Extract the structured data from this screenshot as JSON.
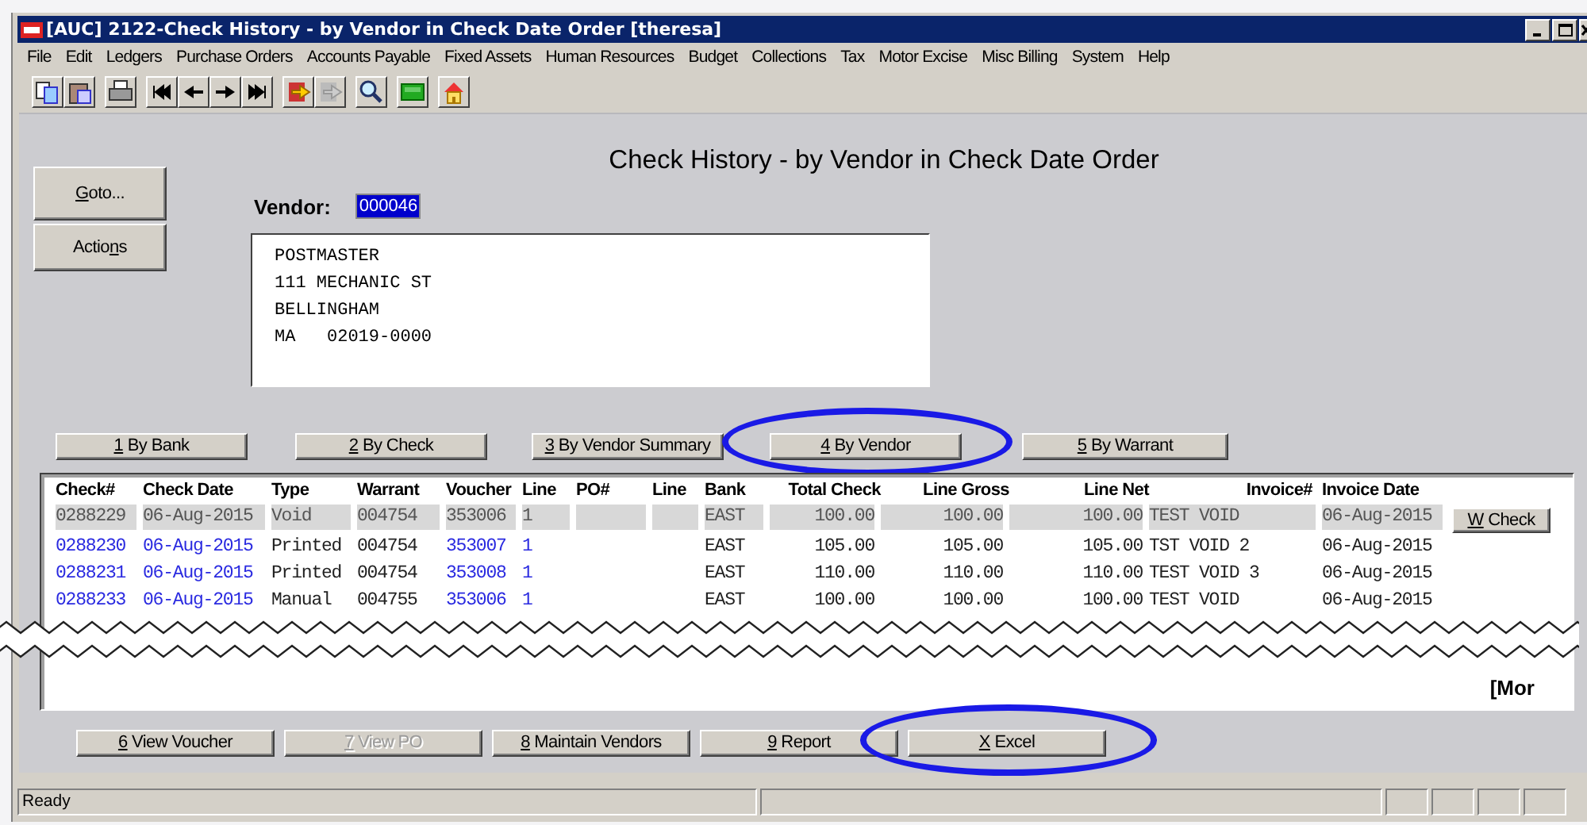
{
  "window": {
    "title": "[AUC] 2122-Check History - by Vendor in Check Date Order [theresa]"
  },
  "menu": [
    "File",
    "Edit",
    "Ledgers",
    "Purchase Orders",
    "Accounts Payable",
    "Fixed Assets",
    "Human Resources",
    "Budget",
    "Collections",
    "Tax",
    "Motor Excise",
    "Misc Billing",
    "System",
    "Help"
  ],
  "side_buttons": [
    {
      "label": "Goto..."
    },
    {
      "label": "Actions"
    }
  ],
  "heading": "Check History - by Vendor in Check Date Order",
  "vendor": {
    "label": "Vendor:",
    "value": "000046"
  },
  "address": [
    "POSTMASTER",
    "111 MECHANIC ST",
    "BELLINGHAM",
    "MA   02019-0000"
  ],
  "view_tabs": [
    {
      "label": "1 By Bank",
      "circled": false
    },
    {
      "label": "2 By Check",
      "circled": false
    },
    {
      "label": "3 By Vendor Summary",
      "circled": false
    },
    {
      "label": "4 By Vendor",
      "circled": true
    },
    {
      "label": "5 By Warrant",
      "circled": false
    }
  ],
  "table": {
    "columns": [
      {
        "label": "Check#",
        "kind": "link"
      },
      {
        "label": "Check Date",
        "kind": "link"
      },
      {
        "label": "Type",
        "kind": "text"
      },
      {
        "label": "Warrant",
        "kind": "text"
      },
      {
        "label": "Voucher",
        "kind": "link"
      },
      {
        "label": "Line",
        "kind": "link"
      },
      {
        "label": "PO#",
        "kind": "text"
      },
      {
        "label": "Line",
        "kind": "text"
      },
      {
        "label": "Bank",
        "kind": "text"
      },
      {
        "label": "Total Check",
        "kind": "text"
      },
      {
        "label": "Line Gross",
        "kind": "text"
      },
      {
        "label": "Line Net",
        "kind": "text"
      },
      {
        "label": "Invoice#",
        "kind": "text"
      },
      {
        "label": "Invoice Date",
        "kind": "text"
      }
    ],
    "rows": [
      {
        "selected": true,
        "cells": [
          "0288229",
          "06-Aug-2015",
          "Void",
          "004754",
          "353006",
          "1",
          "",
          "",
          "EAST",
          "100.00",
          "100.00",
          "100.00",
          "TEST VOID",
          "06-Aug-2015"
        ]
      },
      {
        "selected": false,
        "cells": [
          "0288230",
          "06-Aug-2015",
          "Printed",
          "004754",
          "353007",
          "1",
          "",
          "",
          "EAST",
          "105.00",
          "105.00",
          "105.00",
          "TST VOID 2",
          "06-Aug-2015"
        ]
      },
      {
        "selected": false,
        "cells": [
          "0288231",
          "06-Aug-2015",
          "Printed",
          "004754",
          "353008",
          "1",
          "",
          "",
          "EAST",
          "110.00",
          "110.00",
          "110.00",
          "TEST VOID 3",
          "06-Aug-2015"
        ]
      },
      {
        "selected": false,
        "cells": [
          "0288233",
          "06-Aug-2015",
          "Manual",
          "004755",
          "353006",
          "1",
          "",
          "",
          "EAST",
          "100.00",
          "100.00",
          "100.00",
          "TEST VOID",
          "06-Aug-2015"
        ]
      }
    ],
    "row_button": {
      "label": "W Check"
    },
    "more": "[Mor"
  },
  "actions": [
    {
      "label": "6 View Voucher",
      "disabled": false,
      "circled": false
    },
    {
      "label": "7 View PO",
      "disabled": true,
      "circled": false
    },
    {
      "label": "8 Maintain Vendors",
      "disabled": false,
      "circled": false
    },
    {
      "label": "9 Report",
      "disabled": false,
      "circled": false
    },
    {
      "label": "X Excel",
      "disabled": false,
      "circled": true
    }
  ],
  "status": "Ready"
}
